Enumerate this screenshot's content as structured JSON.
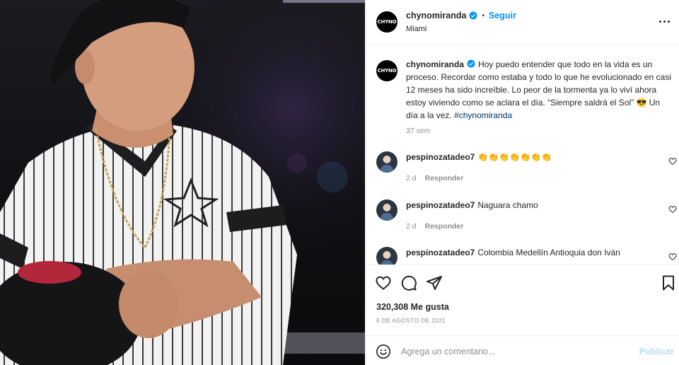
{
  "account": {
    "username": "chynomiranda",
    "avatar_text": "CHYNO",
    "follow_label": "Seguir",
    "separator": "•",
    "location": "Miami"
  },
  "caption": {
    "username": "chynomiranda",
    "text": "Hoy puedo entender que todo en la vida es un proceso. Recordar como estaba y todo lo que he evolucionado en casi 12 meses ha sido increíble. Lo peor de la tormenta ya lo viví ahora estoy viviendo como se aclara el día. “Siempre saldrá el Sol” 😎 Un día a la vez.",
    "hashtag": "#chynomiranda",
    "time": "37 sem"
  },
  "comments": [
    {
      "username": "pespinozatadeo7",
      "text": "👏👏👏👏👏👏👏",
      "time": "2 d",
      "reply_label": "Responder"
    },
    {
      "username": "pespinozatadeo7",
      "text": "Naguara chamo",
      "time": "2 d",
      "reply_label": "Responder"
    },
    {
      "username": "pespinozatadeo7",
      "text": "Colombia Medellín Antioquia don Iván",
      "time": "",
      "reply_label": ""
    }
  ],
  "stats": {
    "likes": "320,308 Me gusta",
    "date": "6 de agosto de 2021"
  },
  "composer": {
    "placeholder": "Agrega un comentario...",
    "publish_label": "Publicar"
  },
  "icons": {
    "verified": "verified-badge-icon",
    "more": "more-options-icon",
    "like": "heart-icon",
    "comment": "comment-icon",
    "share": "share-icon",
    "save": "bookmark-icon",
    "emoji": "emoji-icon"
  },
  "colors": {
    "accent": "#0095f6",
    "hashtag": "#00376b",
    "muted": "#8e8e8e",
    "publish_disabled": "#b2dffc"
  }
}
